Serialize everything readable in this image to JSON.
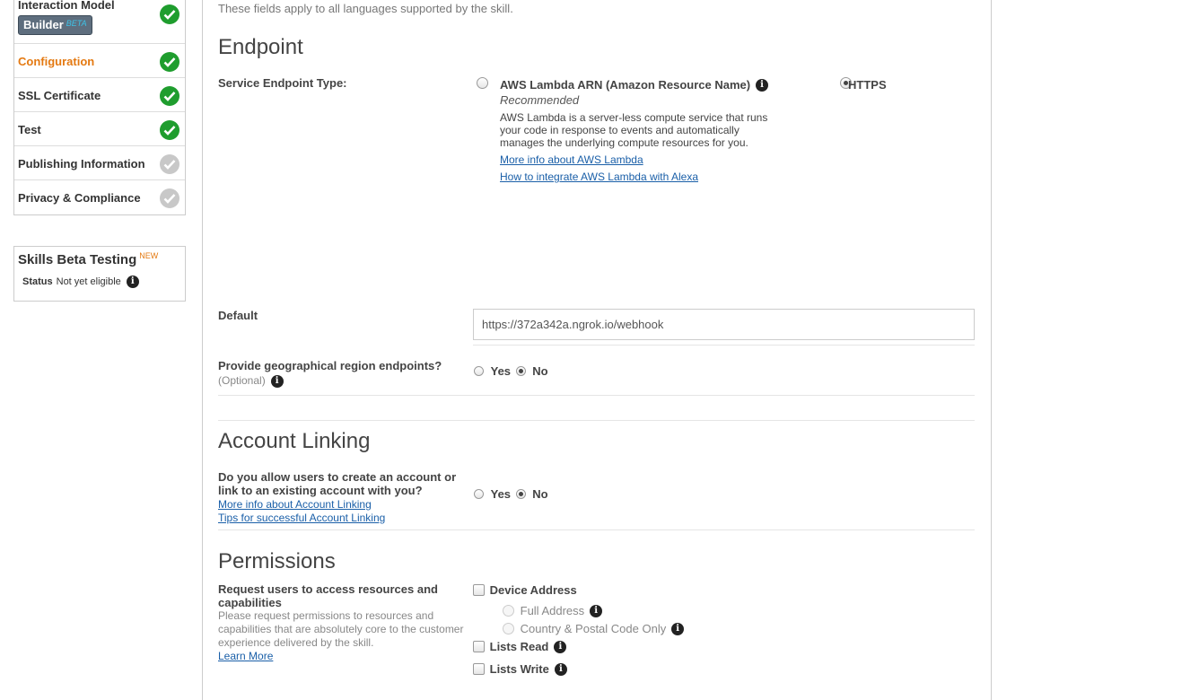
{
  "sidebar": {
    "items": [
      {
        "label": "Interaction Model",
        "badge": "Builder",
        "badge_tag": "BETA",
        "status": "complete"
      },
      {
        "label": "Configuration",
        "status": "complete",
        "active": true
      },
      {
        "label": "SSL Certificate",
        "status": "complete"
      },
      {
        "label": "Test",
        "status": "complete"
      },
      {
        "label": "Publishing Information",
        "status": "pending"
      },
      {
        "label": "Privacy & Compliance",
        "status": "pending"
      }
    ],
    "beta_testing": {
      "title": "Skills Beta Testing",
      "tag": "NEW",
      "status_label": "Status",
      "status_value": "Not yet eligible"
    }
  },
  "main": {
    "intro": "These fields apply to all languages supported by the skill.",
    "endpoint": {
      "title": "Endpoint",
      "type_label": "Service Endpoint Type:",
      "lambda": {
        "label": "AWS Lambda ARN (Amazon Resource Name)",
        "recommended": "Recommended",
        "description": "AWS Lambda is a server-less compute service that runs your code in response to events and automatically manages the underlying compute resources for you.",
        "link1": "More info about AWS Lambda",
        "link2": "How to integrate AWS Lambda with Alexa",
        "selected": false
      },
      "https": {
        "label": "HTTPS",
        "selected": true
      },
      "default_label": "Default",
      "default_value": "https://372a342a.ngrok.io/webhook",
      "geo_label": "Provide geographical region endpoints?",
      "geo_optional": "(Optional)",
      "geo_yes": "Yes",
      "geo_no": "No",
      "geo_selected": "No"
    },
    "account_linking": {
      "title": "Account Linking",
      "question": "Do you allow users to create an account or link to an existing account with you?",
      "link1": "More info about Account Linking",
      "link2": "Tips for successful Account Linking",
      "yes": "Yes",
      "no": "No",
      "selected": "No"
    },
    "permissions": {
      "title": "Permissions",
      "label": "Request users to access resources and capabilities",
      "description": "Please request permissions to resources and capabilities that are absolutely core to the customer experience delivered by the skill.",
      "learn_more": "Learn More",
      "device_address": "Device Address",
      "full_address": "Full Address",
      "country_postal": "Country & Postal Code Only",
      "lists_read": "Lists Read",
      "lists_write": "Lists Write"
    }
  },
  "colors": {
    "accent": "#e47911",
    "success": "#1f9d2e",
    "pending": "#c8c8c8",
    "link": "#1a5fa8"
  }
}
